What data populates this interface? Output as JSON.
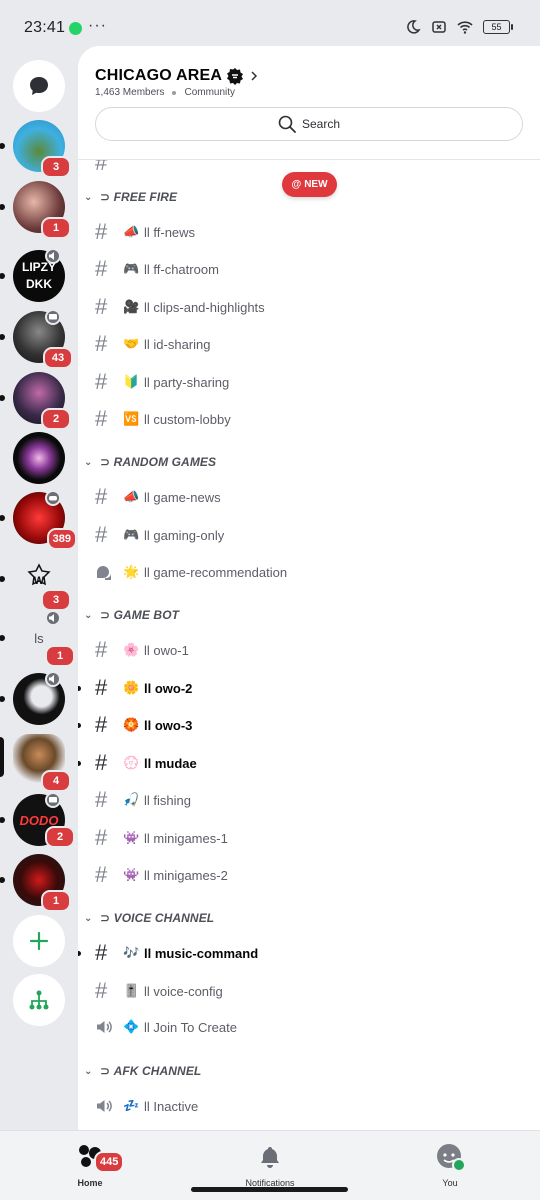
{
  "status_bar": {
    "time": "23:41",
    "more": "···",
    "battery": "55"
  },
  "rail": {
    "servers": [
      {
        "label": "",
        "badge": "3"
      },
      {
        "label": "",
        "badge": "1"
      },
      {
        "label": "LIPZY\nDKK",
        "badge": ""
      },
      {
        "label": "",
        "badge": "43"
      },
      {
        "label": "",
        "badge": "2"
      },
      {
        "label": "",
        "badge": ""
      },
      {
        "label": "",
        "badge": "389"
      },
      {
        "label": "",
        "badge": "3"
      },
      {
        "label": "ls",
        "badge": "1"
      },
      {
        "label": "",
        "badge": ""
      },
      {
        "label": "",
        "badge": "4"
      },
      {
        "label": "DODO",
        "badge": "2"
      },
      {
        "label": "",
        "badge": "1"
      }
    ]
  },
  "server": {
    "name": "CHICAGO AREA",
    "members": "1,463 Members",
    "type": "Community",
    "search_label": "Search",
    "new_label": "NEW"
  },
  "categories": {
    "free_fire": "FREE FIRE",
    "random_games": "RANDOM GAMES",
    "game_bot": "GAME BOT",
    "voice_channel": "VOICE CHANNEL",
    "afk_channel": "AFK CHANNEL"
  },
  "channels": {
    "ff_news": {
      "emoji": "📣",
      "name": "ll ff-news"
    },
    "ff_chatroom": {
      "emoji": "🎮",
      "name": "ll ff-chatroom"
    },
    "clips": {
      "emoji": "🎥",
      "name": "ll clips-and-highlights"
    },
    "id_sharing": {
      "emoji": "🤝",
      "name": "ll id-sharing"
    },
    "party_sharing": {
      "emoji": "🔰",
      "name": "ll party-sharing"
    },
    "custom_lobby": {
      "emoji": "🆚",
      "name": "ll custom-lobby"
    },
    "game_news": {
      "emoji": "📣",
      "name": "ll game-news"
    },
    "gaming_only": {
      "emoji": "🎮",
      "name": "ll gaming-only"
    },
    "game_rec": {
      "emoji": "🌟",
      "name": "ll game-recommendation"
    },
    "owo1": {
      "emoji": "🌸",
      "name": "ll owo-1"
    },
    "owo2": {
      "emoji": "🌼",
      "name": "ll owo-2"
    },
    "owo3": {
      "emoji": "🏵️",
      "name": "ll owo-3"
    },
    "mudae": {
      "emoji": "💮",
      "name": "ll mudae"
    },
    "fishing": {
      "emoji": "🎣",
      "name": "ll fishing"
    },
    "minigames1": {
      "emoji": "👾",
      "name": "ll minigames-1"
    },
    "minigames2": {
      "emoji": "👾",
      "name": "ll minigames-2"
    },
    "music_command": {
      "emoji": "🎶",
      "name": "ll music-command"
    },
    "voice_config": {
      "emoji": "🎚️",
      "name": "ll voice-config"
    },
    "join_to_create": {
      "emoji": "💠",
      "name": "ll Join To Create"
    },
    "inactive": {
      "emoji": "💤",
      "name": "ll Inactive"
    }
  },
  "bottom_nav": {
    "home": "Home",
    "home_badge": "445",
    "notifications": "Notifications",
    "you": "You"
  },
  "colors": {
    "badge_red": "#d83c3e",
    "online_green": "#23a55a",
    "new_pill": "#e0393d"
  }
}
